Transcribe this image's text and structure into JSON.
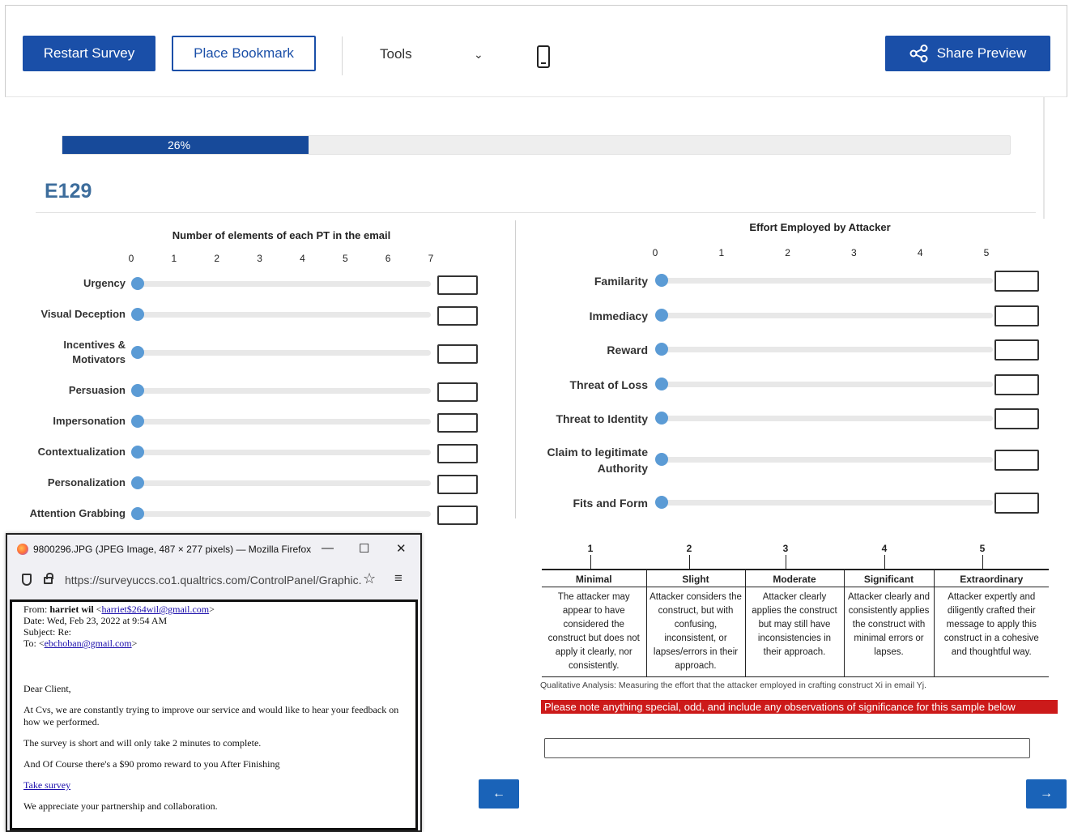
{
  "toolbar": {
    "restart_label": "Restart Survey",
    "bookmark_label": "Place Bookmark",
    "tools_label": "Tools",
    "tools_chevron": "⌄",
    "share_label": "Share Preview"
  },
  "progress": {
    "percent": 26,
    "label": "26%"
  },
  "question": {
    "id": "E129"
  },
  "left_slider": {
    "title": "Number of elements of each PT in the email",
    "ticks": [
      "0",
      "1",
      "2",
      "3",
      "4",
      "5",
      "6",
      "7"
    ],
    "rows": [
      {
        "label": "Urgency",
        "value": 0
      },
      {
        "label": "Visual Deception",
        "value": 0
      },
      {
        "label": "Incentives & Motivators",
        "value": 0
      },
      {
        "label": "Persuasion",
        "value": 0
      },
      {
        "label": "Impersonation",
        "value": 0
      },
      {
        "label": "Contextualization",
        "value": 0
      },
      {
        "label": "Personalization",
        "value": 0
      },
      {
        "label": "Attention Grabbing",
        "value": 0
      }
    ]
  },
  "right_slider": {
    "title": "Effort Employed by Attacker",
    "ticks": [
      "0",
      "1",
      "2",
      "3",
      "4",
      "5"
    ],
    "rows": [
      {
        "label": "Familarity",
        "value": 0
      },
      {
        "label": "Immediacy",
        "value": 0
      },
      {
        "label": "Reward",
        "value": 0
      },
      {
        "label": "Threat of Loss",
        "value": 0
      },
      {
        "label": "Threat to Identity",
        "value": 0
      },
      {
        "label": "Claim to legitimate Authority",
        "value": 0
      },
      {
        "label": "Fits and Form",
        "value": 0
      }
    ]
  },
  "rubric": {
    "numbers": [
      "1",
      "2",
      "3",
      "4",
      "5"
    ],
    "levels": [
      {
        "name": "Minimal",
        "desc": "The attacker may appear to have considered the construct but does not apply it clearly, nor consistently."
      },
      {
        "name": "Slight",
        "desc": "Attacker considers the construct, but with confusing, inconsistent, or lapses/errors in their approach."
      },
      {
        "name": "Moderate",
        "desc": "Attacker clearly applies the construct but may still have inconsistencies in their approach."
      },
      {
        "name": "Significant",
        "desc": "Attacker clearly and consistently applies the construct with minimal errors or lapses."
      },
      {
        "name": "Extraordinary",
        "desc": "Attacker expertly and diligently crafted their message to apply this construct in a cohesive and thoughtful way."
      }
    ],
    "note": "Qualitative Analysis: Measuring the effort that the attacker employed in crafting construct Xi in email Yj."
  },
  "banner": {
    "text": "Please note anything special, odd, and include any observations of significance for this sample below"
  },
  "nav": {
    "back": "←",
    "next": "→"
  },
  "firefox": {
    "title": "9800296.JPG (JPEG Image, 487 × 277 pixels) — Mozilla Firefox",
    "minimize": "—",
    "maximize": "☐",
    "close": "✕",
    "url": "https://surveyuccs.co1.qualtrics.com/ControlPanel/Graphic.",
    "star": "☆",
    "menu": "≡"
  },
  "email": {
    "from_label": "From:",
    "from_name": "harriet wil",
    "from_addr": "harriet$264wil@gmail.com",
    "date_label": "Date:",
    "date": "Wed, Feb 23, 2022 at 9:54 AM",
    "subject_label": "Subject:",
    "subject": "Re:",
    "to_label": "To:",
    "to_addr": "ebchoban@gmail.com",
    "greeting": "Dear Client,",
    "para1": "At Cvs, we are constantly trying to improve our service and would like to hear your feedback on how we performed.",
    "para2": "The survey is short and will only take 2 minutes to complete.",
    "para3": "And Of Course there's a $90 promo reward to you After Finishing",
    "link": "Take survey",
    "para4": "We appreciate your partnership and collaboration."
  }
}
